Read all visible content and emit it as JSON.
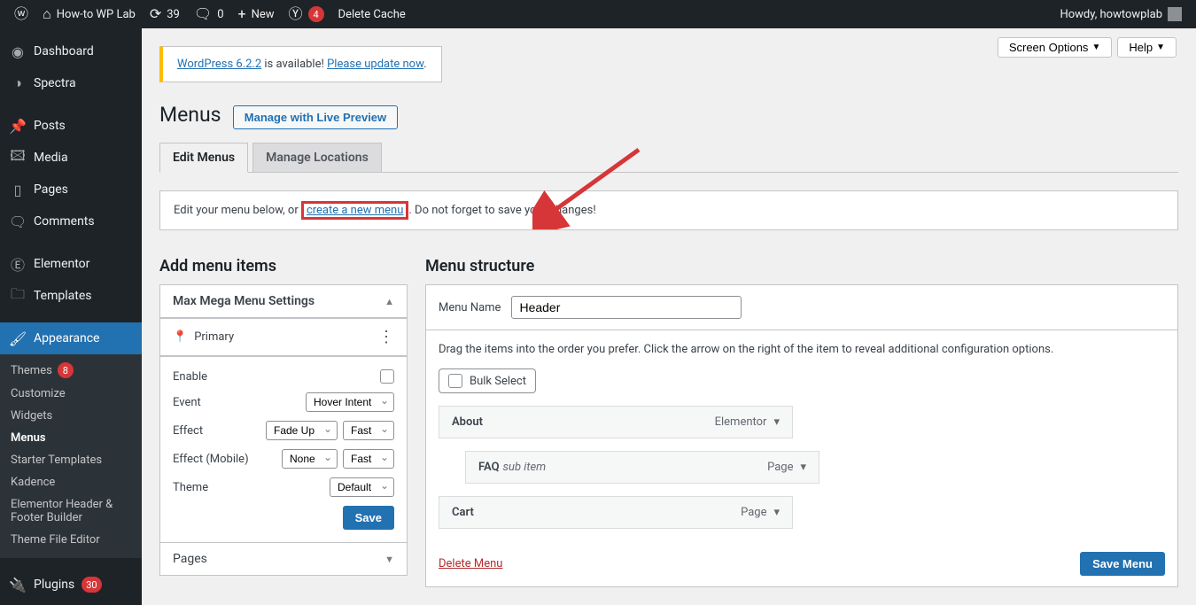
{
  "adminbar": {
    "site_name": "How-to WP Lab",
    "updates": "39",
    "comments": "0",
    "new": "New",
    "yoast_count": "4",
    "delete_cache": "Delete Cache",
    "howdy": "Howdy, howtowplab"
  },
  "sidemenu": {
    "dashboard": "Dashboard",
    "spectra": "Spectra",
    "posts": "Posts",
    "media": "Media",
    "pages": "Pages",
    "comments": "Comments",
    "elementor": "Elementor",
    "templates": "Templates",
    "appearance": "Appearance",
    "plugins": "Plugins",
    "plugins_count": "30",
    "submenu": {
      "themes": "Themes",
      "themes_count": "8",
      "customize": "Customize",
      "widgets": "Widgets",
      "menus": "Menus",
      "starter_templates": "Starter Templates",
      "kadence": "Kadence",
      "ehf": "Elementor Header & Footer Builder",
      "tfe": "Theme File Editor"
    }
  },
  "top_buttons": {
    "screen_options": "Screen Options",
    "help": "Help"
  },
  "update_nag": {
    "prefix_link": "WordPress 6.2.2",
    "middle": " is available! ",
    "suffix_link": "Please update now"
  },
  "heading": {
    "title": "Menus",
    "live_preview": "Manage with Live Preview"
  },
  "tabs": {
    "edit": "Edit Menus",
    "locations": "Manage Locations"
  },
  "notice": {
    "before": "Edit your menu below, or ",
    "link": "create a new menu",
    "after": ". Do not forget to save your changes!"
  },
  "cols": {
    "left_title": "Add menu items",
    "right_title": "Menu structure"
  },
  "mega": {
    "title": "Max Mega Menu Settings",
    "location": "Primary",
    "rows": {
      "enable": "Enable",
      "event": "Event",
      "event_val": "Hover Intent",
      "effect": "Effect",
      "effect_val": "Fade Up",
      "effect_speed": "Fast",
      "effect_mobile": "Effect (Mobile)",
      "effect_mobile_val": "None",
      "effect_mobile_speed": "Fast",
      "theme": "Theme",
      "theme_val": "Default"
    },
    "save": "Save"
  },
  "pages_panel": "Pages",
  "menu_edit": {
    "name_label": "Menu Name",
    "name_value": "Header",
    "instructions": "Drag the items into the order you prefer. Click the arrow on the right of the item to reveal additional configuration options.",
    "bulk_select": "Bulk Select",
    "items": [
      {
        "title": "About",
        "type": "Elementor",
        "indent": false
      },
      {
        "title": "FAQ",
        "sub": "sub item",
        "type": "Page",
        "indent": true
      },
      {
        "title": "Cart",
        "type": "Page",
        "indent": false
      }
    ],
    "delete": "Delete Menu",
    "save": "Save Menu"
  }
}
